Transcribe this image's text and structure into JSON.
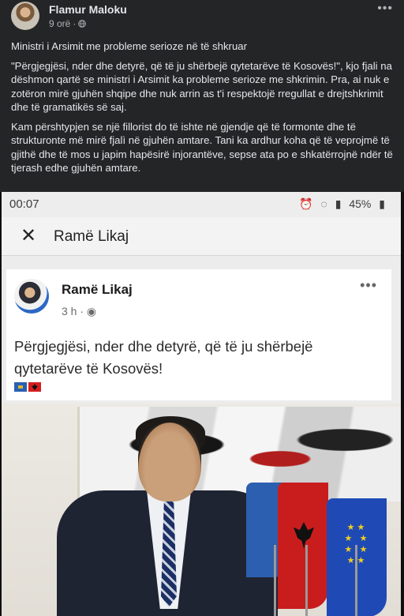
{
  "post": {
    "author": "Flamur Maloku",
    "time": "9 orë",
    "separator": "·",
    "more": "•••",
    "paragraphs": [
      "Ministri i Arsimit me probleme serioze në të shkruar",
      "\"Përgjegjësi, nder dhe detyrë, që të ju shërbejë qytetarëve të Kosovës!\", kjo fjali na dëshmon qartë se ministri i Arsimit ka probleme serioze me shkrimin. Pra, ai nuk e zotëron mirë gjuhën shqipe dhe nuk arrin as t'i respektojë rregullat e drejtshkrimit dhe të gramatikës së saj.",
      "Kam përshtypjen se një fillorist do të ishte në gjendje që të formonte dhe të strukturonte më mirë fjalì në gjuhën amtare. Tani ka ardhur koha që të veprojmë të gjithë dhe të mos u japim hapësirë injorantëve, sepse ata po e shkatërrojnë ndër të tjerash edhe gjuhën amtare."
    ]
  },
  "photo": {
    "status_time": "00:07",
    "battery": "45%",
    "search_title": "Ramë Likaj",
    "inner_post": {
      "author": "Ramë Likaj",
      "time": "3 h",
      "separator": "·",
      "more": "•••",
      "text": "Përgjegjësi, nder dhe detyrë, që të ju shërbejë qytetarëve të Kosovës!",
      "flags": [
        "🇽🇰",
        "🇦🇱"
      ]
    }
  },
  "icons": {
    "globe": "globe-icon",
    "close": "close-icon",
    "more": "more-icon"
  },
  "colors": {
    "background": "#242526",
    "text": "#e4e6eb",
    "secondary_text": "#b0b3b8"
  }
}
